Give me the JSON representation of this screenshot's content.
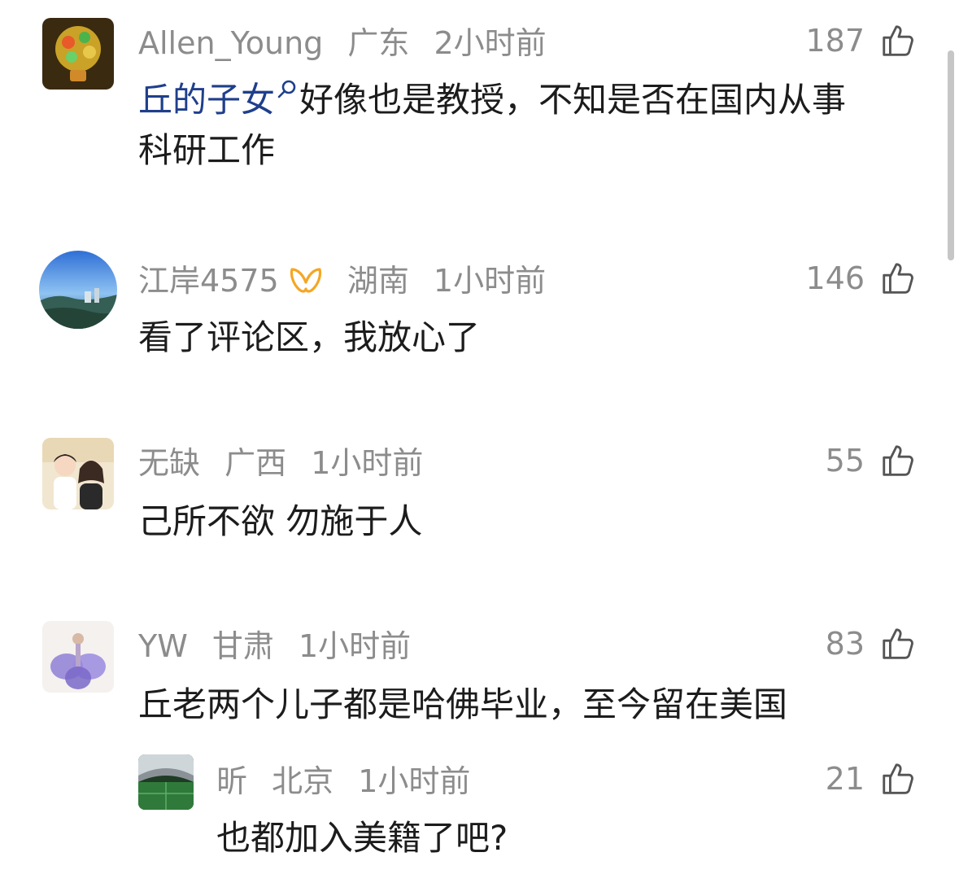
{
  "comments": [
    {
      "username": "Allen_Young",
      "location": "广东",
      "time": "2小时前",
      "likes": "187",
      "mention": "丘的子女",
      "text": "好像也是教授，不知是否在国内从事",
      "text_line2": "科研工作"
    },
    {
      "username": "江岸4575",
      "location": "湖南",
      "time": "1小时前",
      "likes": "146",
      "text": "看了评论区，我放心了"
    },
    {
      "username": "无缺",
      "location": "广西",
      "time": "1小时前",
      "likes": "55",
      "text": "己所不欲 勿施于人"
    },
    {
      "username": "YW",
      "location": "甘肃",
      "time": "1小时前",
      "likes": "83",
      "text": "丘老两个儿子都是哈佛毕业，至今留在美国"
    }
  ],
  "reply": {
    "username": "昕",
    "location": "北京",
    "time": "1小时前",
    "likes": "21",
    "text": "也都加入美籍了吧?"
  },
  "icons": {
    "like": "thumbs-up-icon",
    "mention_search": "search-icon",
    "member_badge": "vip-badge-icon"
  },
  "colors": {
    "meta_text": "#8c8c8c",
    "body_text": "#1c1c1c",
    "mention": "#1f3f8c",
    "badge": "#f5a623"
  }
}
